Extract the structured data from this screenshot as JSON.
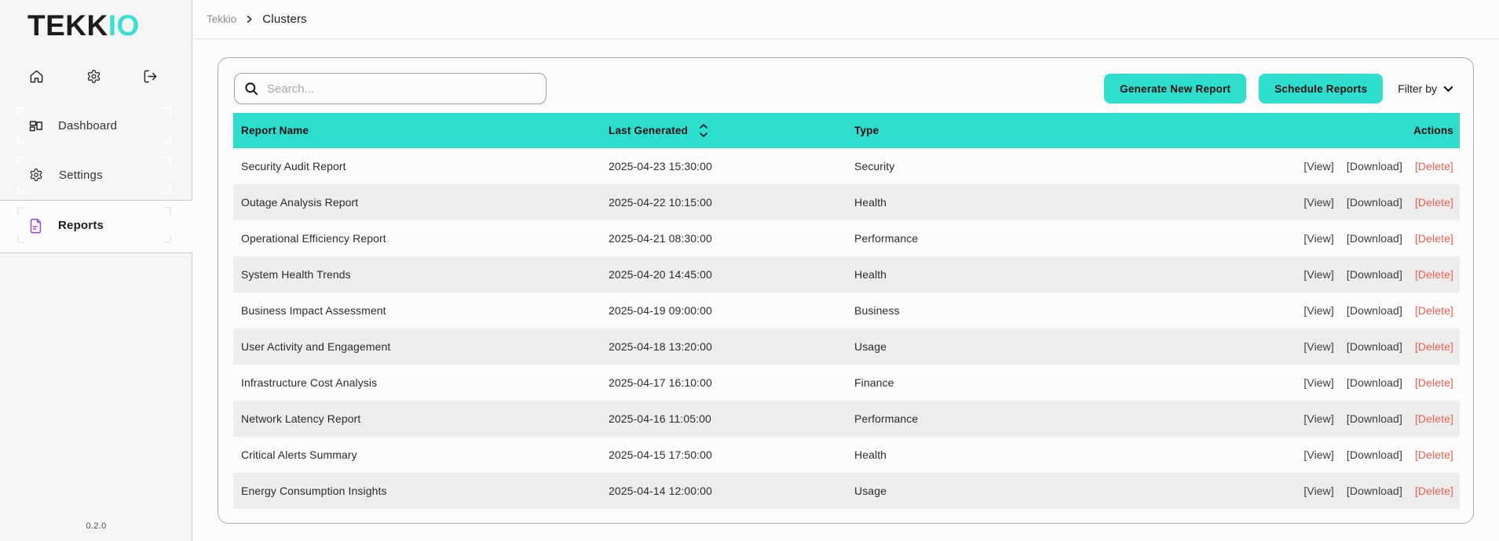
{
  "brand": {
    "name_primary": "TEKK",
    "name_accent": "IO",
    "version": "0.2.0"
  },
  "colors": {
    "accent": "#2BDECD",
    "accent_logo": "#38E1D1",
    "delete": "#EE5D4D",
    "reports_icon_purple": "#9747E6"
  },
  "breadcrumb": {
    "root": "Tekkio",
    "current": "Clusters"
  },
  "sidebar": {
    "quick_icons": [
      "home-icon",
      "gear-icon",
      "logout-icon"
    ],
    "items": [
      {
        "label": "Dashboard",
        "icon": "dashboard-icon",
        "active": false
      },
      {
        "label": "Settings",
        "icon": "gear-icon",
        "active": false
      },
      {
        "label": "Reports",
        "icon": "file-icon",
        "active": true
      }
    ]
  },
  "toolbar": {
    "search_placeholder": "Search...",
    "search_value": "",
    "generate_label": "Generate New Report",
    "schedule_label": "Schedule Reports",
    "filter_label": "Filter by"
  },
  "table": {
    "columns": [
      "Report Name",
      "Last Generated",
      "Type",
      "Actions"
    ],
    "sorted_column": "Last Generated",
    "action_labels": {
      "view": "[View]",
      "download": "[Download]",
      "delete": "[Delete]"
    },
    "rows": [
      {
        "name": "Security Audit Report",
        "generated": "2025-04-23 15:30:00",
        "type": "Security"
      },
      {
        "name": "Outage Analysis Report",
        "generated": "2025-04-22 10:15:00",
        "type": "Health"
      },
      {
        "name": "Operational Efficiency Report",
        "generated": "2025-04-21 08:30:00",
        "type": "Performance"
      },
      {
        "name": "System Health Trends",
        "generated": "2025-04-20 14:45:00",
        "type": "Health"
      },
      {
        "name": "Business Impact Assessment",
        "generated": "2025-04-19 09:00:00",
        "type": "Business"
      },
      {
        "name": "User Activity and Engagement",
        "generated": "2025-04-18 13:20:00",
        "type": "Usage"
      },
      {
        "name": "Infrastructure Cost Analysis",
        "generated": "2025-04-17 16:10:00",
        "type": "Finance"
      },
      {
        "name": "Network Latency Report",
        "generated": "2025-04-16 11:05:00",
        "type": "Performance"
      },
      {
        "name": "Critical Alerts Summary",
        "generated": "2025-04-15 17:50:00",
        "type": "Health"
      },
      {
        "name": "Energy Consumption Insights",
        "generated": "2025-04-14 12:00:00",
        "type": "Usage"
      }
    ]
  }
}
